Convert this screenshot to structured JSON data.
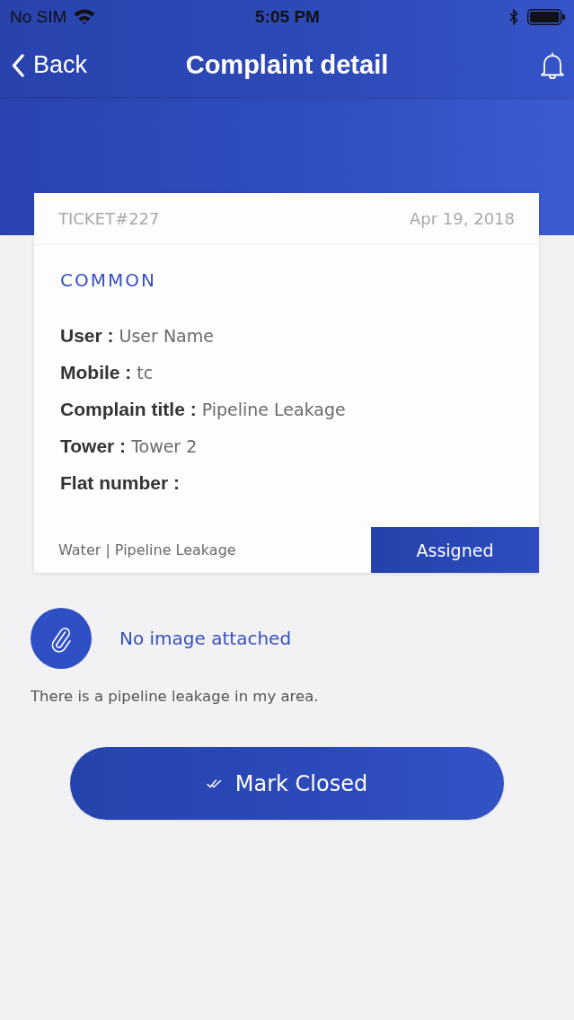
{
  "status_bar": {
    "carrier": "No SIM",
    "time": "5:05 PM"
  },
  "nav_bar": {
    "back": "Back",
    "title": "Complaint detail"
  },
  "ticket": {
    "number": "TICKET#227",
    "date": "Apr 19, 2018",
    "category": "COMMON",
    "fields": [
      {
        "label": "User :",
        "value": "User Name"
      },
      {
        "label": "Mobile :",
        "value": "tc"
      },
      {
        "label": "Complain title :",
        "value": "Pipeline Leakage"
      },
      {
        "label": "Tower :",
        "value": "Tower 2"
      },
      {
        "label": "Flat number :"
      }
    ],
    "type": "Water | Pipeline Leakage",
    "status": "Assigned"
  },
  "attachment": {
    "label": "No image attached"
  },
  "description": "There is a pipeline leakage in my area.",
  "action": {
    "label": "Mark Closed"
  }
}
